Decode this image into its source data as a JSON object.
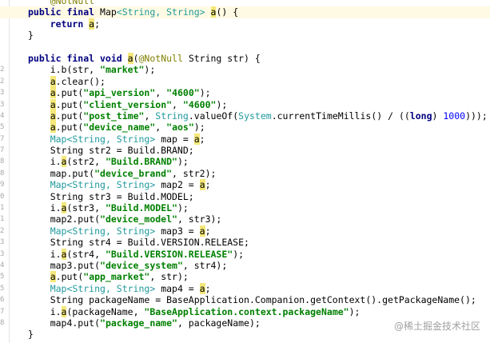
{
  "editor": {
    "lines": [
      {
        "ln": "",
        "current": false,
        "tokens": [
          {
            "t": "    ",
            "c": "pl"
          },
          {
            "t": "@NotNull",
            "c": "ann"
          }
        ]
      },
      {
        "ln": "",
        "current": true,
        "tokens": [
          {
            "t": "public final ",
            "c": "kw"
          },
          {
            "t": "Map",
            "c": "pl"
          },
          {
            "t": "<String, String> ",
            "c": "type"
          },
          {
            "t": "a",
            "c": "hl"
          },
          {
            "t": "() {",
            "c": "pl"
          }
        ]
      },
      {
        "ln": "",
        "current": false,
        "tokens": [
          {
            "t": "    ",
            "c": "pl"
          },
          {
            "t": "return ",
            "c": "kw"
          },
          {
            "t": "a",
            "c": "hl"
          },
          {
            "t": ";",
            "c": "pl"
          }
        ]
      },
      {
        "ln": "",
        "current": false,
        "tokens": [
          {
            "t": "}",
            "c": "pl"
          }
        ]
      },
      {
        "ln": "",
        "current": false,
        "tokens": []
      },
      {
        "ln": "",
        "current": false,
        "tokens": [
          {
            "t": "public final void ",
            "c": "kw"
          },
          {
            "t": "a",
            "c": "hl"
          },
          {
            "t": "(",
            "c": "pl"
          },
          {
            "t": "@NotNull ",
            "c": "ann"
          },
          {
            "t": "String str) {",
            "c": "pl"
          }
        ]
      },
      {
        "ln": "2",
        "current": false,
        "tokens": [
          {
            "t": "    i.b(str, ",
            "c": "pl"
          },
          {
            "t": "\"market\"",
            "c": "str"
          },
          {
            "t": ");",
            "c": "pl"
          }
        ]
      },
      {
        "ln": "2",
        "current": false,
        "tokens": [
          {
            "t": "    ",
            "c": "pl"
          },
          {
            "t": "a",
            "c": "hl"
          },
          {
            "t": ".clear();",
            "c": "pl"
          }
        ]
      },
      {
        "ln": "3",
        "current": false,
        "tokens": [
          {
            "t": "    ",
            "c": "pl"
          },
          {
            "t": "a",
            "c": "hl"
          },
          {
            "t": ".put(",
            "c": "pl"
          },
          {
            "t": "\"api_version\"",
            "c": "str"
          },
          {
            "t": ", ",
            "c": "pl"
          },
          {
            "t": "\"4600\"",
            "c": "str"
          },
          {
            "t": ");",
            "c": "pl"
          }
        ]
      },
      {
        "ln": "3",
        "current": false,
        "tokens": [
          {
            "t": "    ",
            "c": "pl"
          },
          {
            "t": "a",
            "c": "hl"
          },
          {
            "t": ".put(",
            "c": "pl"
          },
          {
            "t": "\"client_version\"",
            "c": "str"
          },
          {
            "t": ", ",
            "c": "pl"
          },
          {
            "t": "\"4600\"",
            "c": "str"
          },
          {
            "t": ");",
            "c": "pl"
          }
        ]
      },
      {
        "ln": "4",
        "current": false,
        "tokens": [
          {
            "t": "    ",
            "c": "pl"
          },
          {
            "t": "a",
            "c": "hl"
          },
          {
            "t": ".put(",
            "c": "pl"
          },
          {
            "t": "\"post_time\"",
            "c": "str"
          },
          {
            "t": ", ",
            "c": "pl"
          },
          {
            "t": "String",
            "c": "type"
          },
          {
            "t": ".valueOf(",
            "c": "pl"
          },
          {
            "t": "System",
            "c": "type"
          },
          {
            "t": ".currentTimeMillis() / ((",
            "c": "pl"
          },
          {
            "t": "long",
            "c": "kw"
          },
          {
            "t": ") ",
            "c": "pl"
          },
          {
            "t": "1000",
            "c": "num"
          },
          {
            "t": ")));",
            "c": "pl"
          }
        ]
      },
      {
        "ln": "5",
        "current": false,
        "tokens": [
          {
            "t": "    ",
            "c": "pl"
          },
          {
            "t": "a",
            "c": "hl"
          },
          {
            "t": ".put(",
            "c": "pl"
          },
          {
            "t": "\"device_name\"",
            "c": "str"
          },
          {
            "t": ", ",
            "c": "pl"
          },
          {
            "t": "\"aos\"",
            "c": "str"
          },
          {
            "t": ");",
            "c": "pl"
          }
        ]
      },
      {
        "ln": "7",
        "current": false,
        "tokens": [
          {
            "t": "    ",
            "c": "pl"
          },
          {
            "t": "Map<String, String> ",
            "c": "type"
          },
          {
            "t": "map = ",
            "c": "pl"
          },
          {
            "t": "a",
            "c": "hl"
          },
          {
            "t": ";",
            "c": "pl"
          }
        ]
      },
      {
        "ln": "7",
        "current": false,
        "tokens": [
          {
            "t": "    String str2 = Build.BRAND;",
            "c": "pl"
          }
        ]
      },
      {
        "ln": "8",
        "current": false,
        "tokens": [
          {
            "t": "    i.",
            "c": "pl"
          },
          {
            "t": "a",
            "c": "hl"
          },
          {
            "t": "(str2, ",
            "c": "pl"
          },
          {
            "t": "\"Build.BRAND\"",
            "c": "str"
          },
          {
            "t": ");",
            "c": "pl"
          }
        ]
      },
      {
        "ln": "8",
        "current": false,
        "tokens": [
          {
            "t": "    map.put(",
            "c": "pl"
          },
          {
            "t": "\"device_brand\"",
            "c": "str"
          },
          {
            "t": ", str2);",
            "c": "pl"
          }
        ]
      },
      {
        "ln": "9",
        "current": false,
        "tokens": [
          {
            "t": "    ",
            "c": "pl"
          },
          {
            "t": "Map<String, String> ",
            "c": "type"
          },
          {
            "t": "map2 = ",
            "c": "pl"
          },
          {
            "t": "a",
            "c": "hl"
          },
          {
            "t": ";",
            "c": "pl"
          }
        ]
      },
      {
        "ln": "0",
        "current": false,
        "tokens": [
          {
            "t": "    String str3 = Build.MODEL;",
            "c": "pl"
          }
        ]
      },
      {
        "ln": "1",
        "current": false,
        "tokens": [
          {
            "t": "    i.",
            "c": "pl"
          },
          {
            "t": "a",
            "c": "hl"
          },
          {
            "t": "(str3, ",
            "c": "pl"
          },
          {
            "t": "\"Build.MODEL\"",
            "c": "str"
          },
          {
            "t": ");",
            "c": "pl"
          }
        ]
      },
      {
        "ln": "1",
        "current": false,
        "tokens": [
          {
            "t": "    map2.put(",
            "c": "pl"
          },
          {
            "t": "\"device_model\"",
            "c": "str"
          },
          {
            "t": ", str3);",
            "c": "pl"
          }
        ]
      },
      {
        "ln": "2",
        "current": false,
        "tokens": [
          {
            "t": "    ",
            "c": "pl"
          },
          {
            "t": "Map<String, String> ",
            "c": "type"
          },
          {
            "t": "map3 = ",
            "c": "pl"
          },
          {
            "t": "a",
            "c": "hl"
          },
          {
            "t": ";",
            "c": "pl"
          }
        ]
      },
      {
        "ln": "3",
        "current": false,
        "tokens": [
          {
            "t": "    String str4 = Build.VERSION.RELEASE;",
            "c": "pl"
          }
        ]
      },
      {
        "ln": "3",
        "current": false,
        "tokens": [
          {
            "t": "    i.",
            "c": "pl"
          },
          {
            "t": "a",
            "c": "hl"
          },
          {
            "t": "(str4, ",
            "c": "pl"
          },
          {
            "t": "\"Build.VERSION.RELEASE\"",
            "c": "str"
          },
          {
            "t": ");",
            "c": "pl"
          }
        ]
      },
      {
        "ln": "4",
        "current": false,
        "tokens": [
          {
            "t": "    map3.put(",
            "c": "pl"
          },
          {
            "t": "\"device_system\"",
            "c": "str"
          },
          {
            "t": ", str4);",
            "c": "pl"
          }
        ]
      },
      {
        "ln": "5",
        "current": false,
        "tokens": [
          {
            "t": "    ",
            "c": "pl"
          },
          {
            "t": "a",
            "c": "hl"
          },
          {
            "t": ".put(",
            "c": "pl"
          },
          {
            "t": "\"app_market\"",
            "c": "str"
          },
          {
            "t": ", str);",
            "c": "pl"
          }
        ]
      },
      {
        "ln": "5",
        "current": false,
        "tokens": [
          {
            "t": "    ",
            "c": "pl"
          },
          {
            "t": "Map<String, String> ",
            "c": "type"
          },
          {
            "t": "map4 = ",
            "c": "pl"
          },
          {
            "t": "a",
            "c": "hl"
          },
          {
            "t": ";",
            "c": "pl"
          }
        ]
      },
      {
        "ln": "6",
        "current": false,
        "tokens": [
          {
            "t": "    String packageName = BaseApplication.Companion.getContext().getPackageName();",
            "c": "pl"
          }
        ]
      },
      {
        "ln": "7",
        "current": false,
        "tokens": [
          {
            "t": "    i.",
            "c": "pl"
          },
          {
            "t": "a",
            "c": "hl"
          },
          {
            "t": "(packageName, ",
            "c": "pl"
          },
          {
            "t": "\"BaseApplication.context.packageName\"",
            "c": "str"
          },
          {
            "t": ");",
            "c": "pl"
          }
        ]
      },
      {
        "ln": "8",
        "current": false,
        "tokens": [
          {
            "t": "    map4.put(",
            "c": "pl"
          },
          {
            "t": "\"package_name\"",
            "c": "str"
          },
          {
            "t": ", packageName);",
            "c": "pl"
          }
        ]
      },
      {
        "ln": "",
        "current": false,
        "tokens": [
          {
            "t": "}",
            "c": "pl"
          }
        ]
      }
    ]
  },
  "watermark": "@稀土掘金技术社区",
  "colors": {
    "keyword": "#000080",
    "string": "#008000",
    "number": "#0000ff",
    "annotation": "#808000",
    "type": "#20999d",
    "highlight": "#f4e87a",
    "current_line": "#fffae3"
  }
}
